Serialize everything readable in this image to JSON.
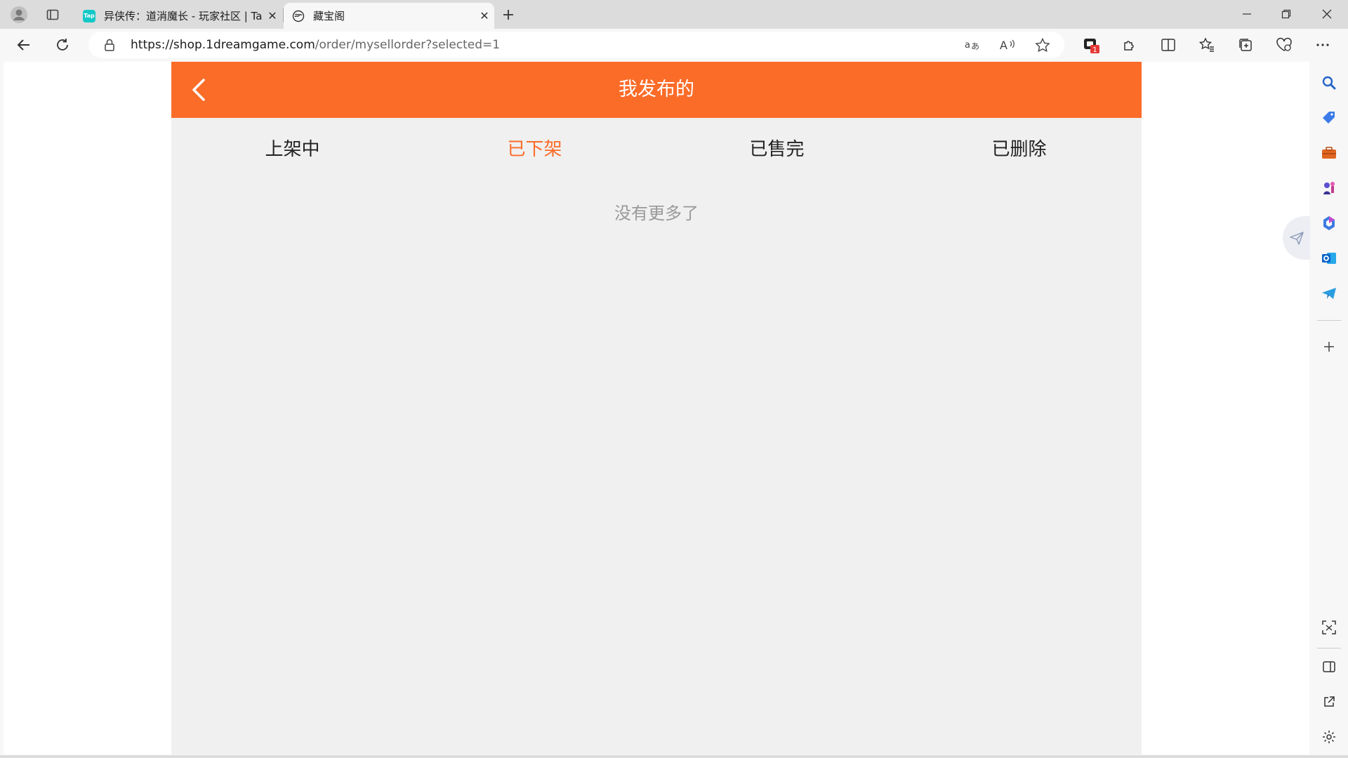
{
  "browser": {
    "tabs": [
      {
        "title": "异侠传：道消魔长 - 玩家社区 | Ta",
        "favicon_text": "Tap",
        "active": false
      },
      {
        "title": "藏宝阁",
        "active": true
      }
    ],
    "url_domain": "https://shop.1dreamgame.com",
    "url_path": "/order/mysellorder?selected=1",
    "extension_badge": "1"
  },
  "page": {
    "header_title": "我发布的",
    "tabs": [
      {
        "label": "上架中",
        "active": false
      },
      {
        "label": "已下架",
        "active": true
      },
      {
        "label": "已售完",
        "active": false
      },
      {
        "label": "已删除",
        "active": false
      }
    ],
    "empty_text": "没有更多了"
  },
  "colors": {
    "accent": "#fb6c29",
    "page_bg": "#f0f0f0"
  }
}
